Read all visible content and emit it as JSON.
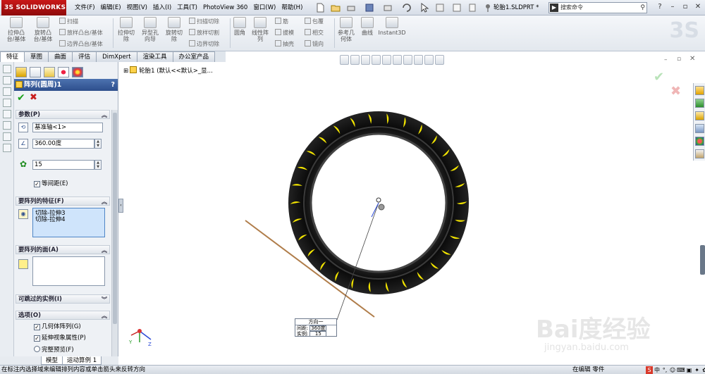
{
  "app": {
    "logo": "3S SOLIDWORKS",
    "doc_title": "轮胎1.SLDPRT *",
    "search_placeholder": "搜索命令",
    "menu": [
      "文件(F)",
      "编辑(E)",
      "视图(V)",
      "插入(I)",
      "工具(T)",
      "PhotoView 360",
      "窗口(W)",
      "帮助(H)"
    ]
  },
  "commands": {
    "boss_extrude": "拉伸凸台/基体",
    "revolve_boss": "旋转凸台/基体",
    "sweep": "扫描",
    "loft_boss": "放样凸台/基体",
    "boundary_boss": "边界凸台/基体",
    "extruded_cut": "拉伸切除",
    "hole_wizard": "异型孔向导",
    "revolved_cut": "旋转切除",
    "swept_cut": "扫描切除",
    "lofted_cut": "放样切割",
    "boundary_cut": "边界切除",
    "fillet": "圆角",
    "linear_pattern": "线性阵列",
    "rib": "筋",
    "draft": "拔模",
    "shell": "抽壳",
    "wrap": "包覆",
    "intersect": "相交",
    "mirror": "镜向",
    "ref_geometry": "参考几何体",
    "curves": "曲线",
    "instant3d": "Instant3D"
  },
  "tabs": [
    "特征",
    "草图",
    "曲面",
    "评估",
    "DimXpert",
    "渲染工具",
    "办公室产品"
  ],
  "active_tab": 0,
  "tree": {
    "root_label": "轮胎1 (默认<<默认>_显..."
  },
  "property_manager": {
    "title": "阵列(圆周)1",
    "help": "?",
    "params": {
      "header": "参数(P)",
      "axis": "基准轴<1>",
      "angle": "360.00度",
      "count": "15",
      "equal_spacing_label": "等间距(E)",
      "equal_spacing_checked": true
    },
    "features": {
      "header": "要阵列的特征(F)",
      "items": [
        "切除-拉伸3",
        "切除-拉伸4"
      ]
    },
    "faces": {
      "header": "要阵列的面(A)"
    },
    "skip": {
      "header": "可跳过的实例(I)"
    },
    "options": {
      "header": "选项(O)",
      "geometry_pattern": "几何体阵列(G)",
      "propagate_visual": "延伸视象属性(P)",
      "full_preview": "完整预览(F)"
    }
  },
  "bottom_tabs": [
    "模型",
    "运动算例 1"
  ],
  "callout": {
    "title": "方向一",
    "spacing_label": "间距:",
    "spacing_value": "360度",
    "instances_label": "实例:",
    "instances_value": "15"
  },
  "status": {
    "message": "在标注内选择域来编辑排列内容或单击箭头来反转方向",
    "mode": "在编辑 零件",
    "ime": [
      "S",
      "中",
      "°,",
      "☺",
      "⌨",
      "▣",
      "✦",
      "✿"
    ]
  },
  "watermark": {
    "main": "Bai度经验",
    "sub": "jingyan.baidu.com"
  },
  "colors": {
    "tire": "#111111",
    "tread_marks": "#f2e400",
    "header_blue": "#2d4f8c",
    "axis_line": "#b07d4a",
    "ok_green": "#1aa11a",
    "cancel_red": "#c81e1e"
  }
}
